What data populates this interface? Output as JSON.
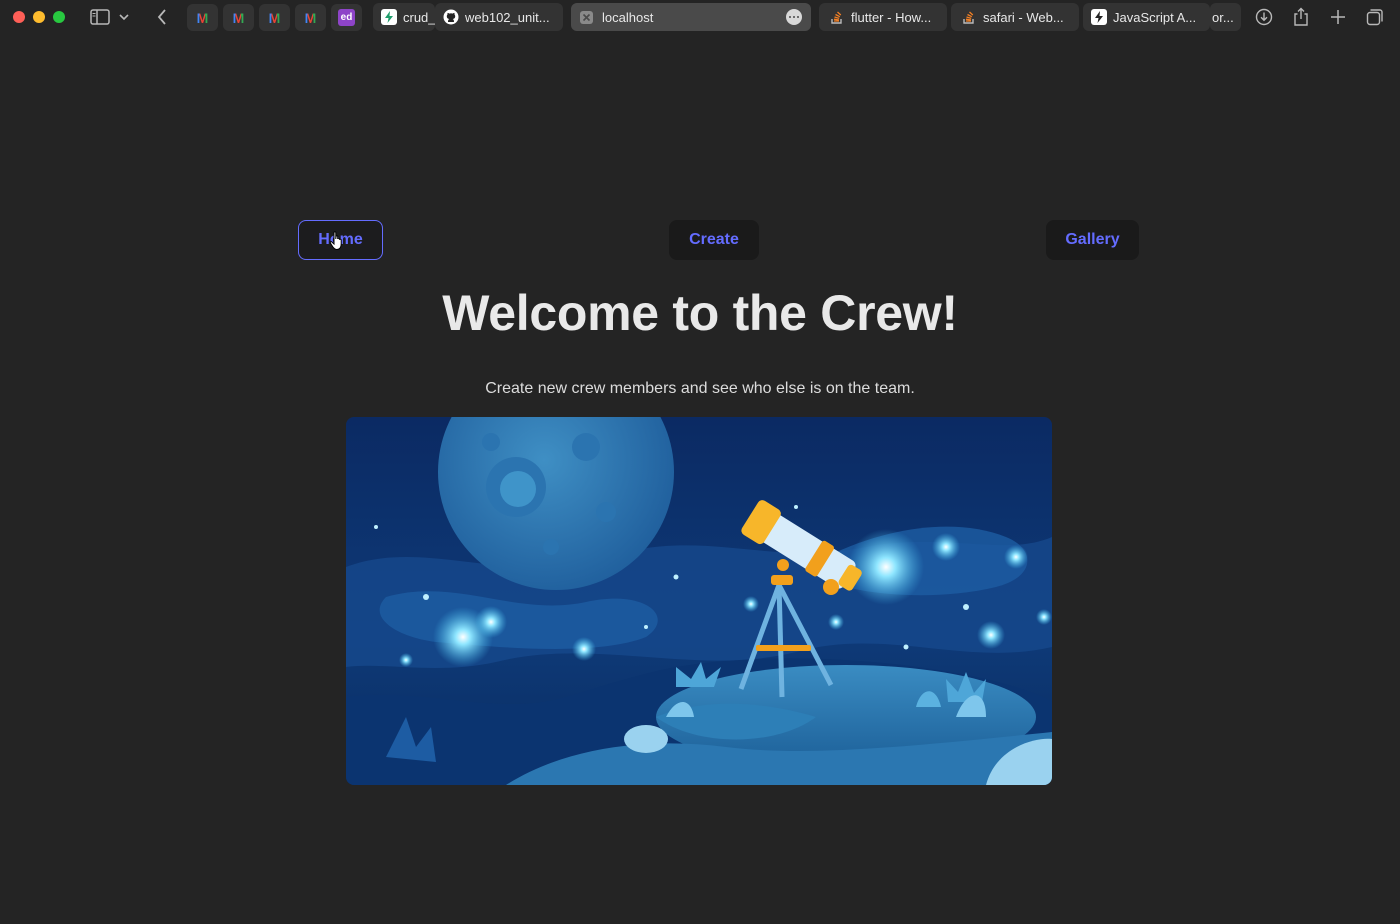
{
  "browser": {
    "tabs": [
      {
        "label": "crud_",
        "favicon": "bolt-icon"
      },
      {
        "label": "web102_unit...",
        "favicon": "github-icon"
      },
      {
        "label": "localhost",
        "favicon": "close-icon",
        "active": true
      },
      {
        "label": "flutter - How...",
        "favicon": "stackoverflow-icon"
      },
      {
        "label": "safari - Web...",
        "favicon": "stackoverflow-icon"
      },
      {
        "label": "JavaScript A...",
        "favicon": "bolt-icon"
      },
      {
        "label": "or...",
        "favicon": ""
      }
    ],
    "pinned": [
      {
        "label": "M",
        "icon": "gmail-icon"
      },
      {
        "label": "M",
        "icon": "gmail-icon"
      },
      {
        "label": "M",
        "icon": "gmail-icon"
      },
      {
        "label": "M",
        "icon": "gmail-icon"
      },
      {
        "label": "ed",
        "icon": "ed-icon"
      }
    ]
  },
  "nav": {
    "home": "Home",
    "create": "Create",
    "gallery": "Gallery"
  },
  "page": {
    "title": "Welcome to the Crew!",
    "subtitle": "Create new crew members and see who else is on the team."
  },
  "colors": {
    "accent": "#646cff",
    "background": "#242424",
    "button_bg": "#1a1a1a"
  }
}
